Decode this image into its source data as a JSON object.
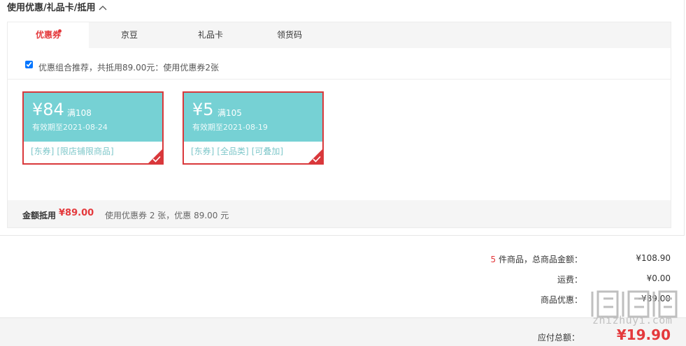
{
  "section": {
    "title": "使用优惠/礼品卡/抵用",
    "chevron": "^"
  },
  "tabs": [
    {
      "label": "优惠券",
      "active": true,
      "has_dot": true
    },
    {
      "label": "京豆"
    },
    {
      "label": "礼品卡"
    },
    {
      "label": "领货码"
    }
  ],
  "combo": {
    "checked": true,
    "text": "优惠组合推荐，共抵用89.00元：使用优惠券2张"
  },
  "coupons": [
    {
      "amount": "¥84",
      "condition": "满108",
      "expiry": "有效期至2021-08-24",
      "tags": [
        "[东券]",
        "[限店铺限商品]"
      ],
      "selected": true
    },
    {
      "amount": "¥5",
      "condition": "满105",
      "expiry": "有效期至2021-08-19",
      "tags": [
        "[东券]",
        "[全品类]",
        "[可叠加]"
      ],
      "selected": true
    }
  ],
  "discount_summary": {
    "label": "金额抵用",
    "amount": "¥89.00",
    "desc": "使用优惠券 2 张，优惠 89.00 元"
  },
  "totals": {
    "item_count": "5",
    "items_label": " 件商品，总商品金额：",
    "items_value": "¥108.90",
    "shipping_label": "运费：",
    "shipping_value": "¥0.00",
    "discount_label": "商品优惠：",
    "discount_value": "-¥89.00"
  },
  "payable": {
    "label": "应付总额：",
    "value": "¥19.90"
  },
  "watermark": {
    "site": "zhizhuyi.com",
    "icon": "zhi-logo-icon"
  },
  "colors": {
    "accent": "#e4393c",
    "coupon_bg": "#76d1d4",
    "coupon_border": "#d9383b"
  }
}
